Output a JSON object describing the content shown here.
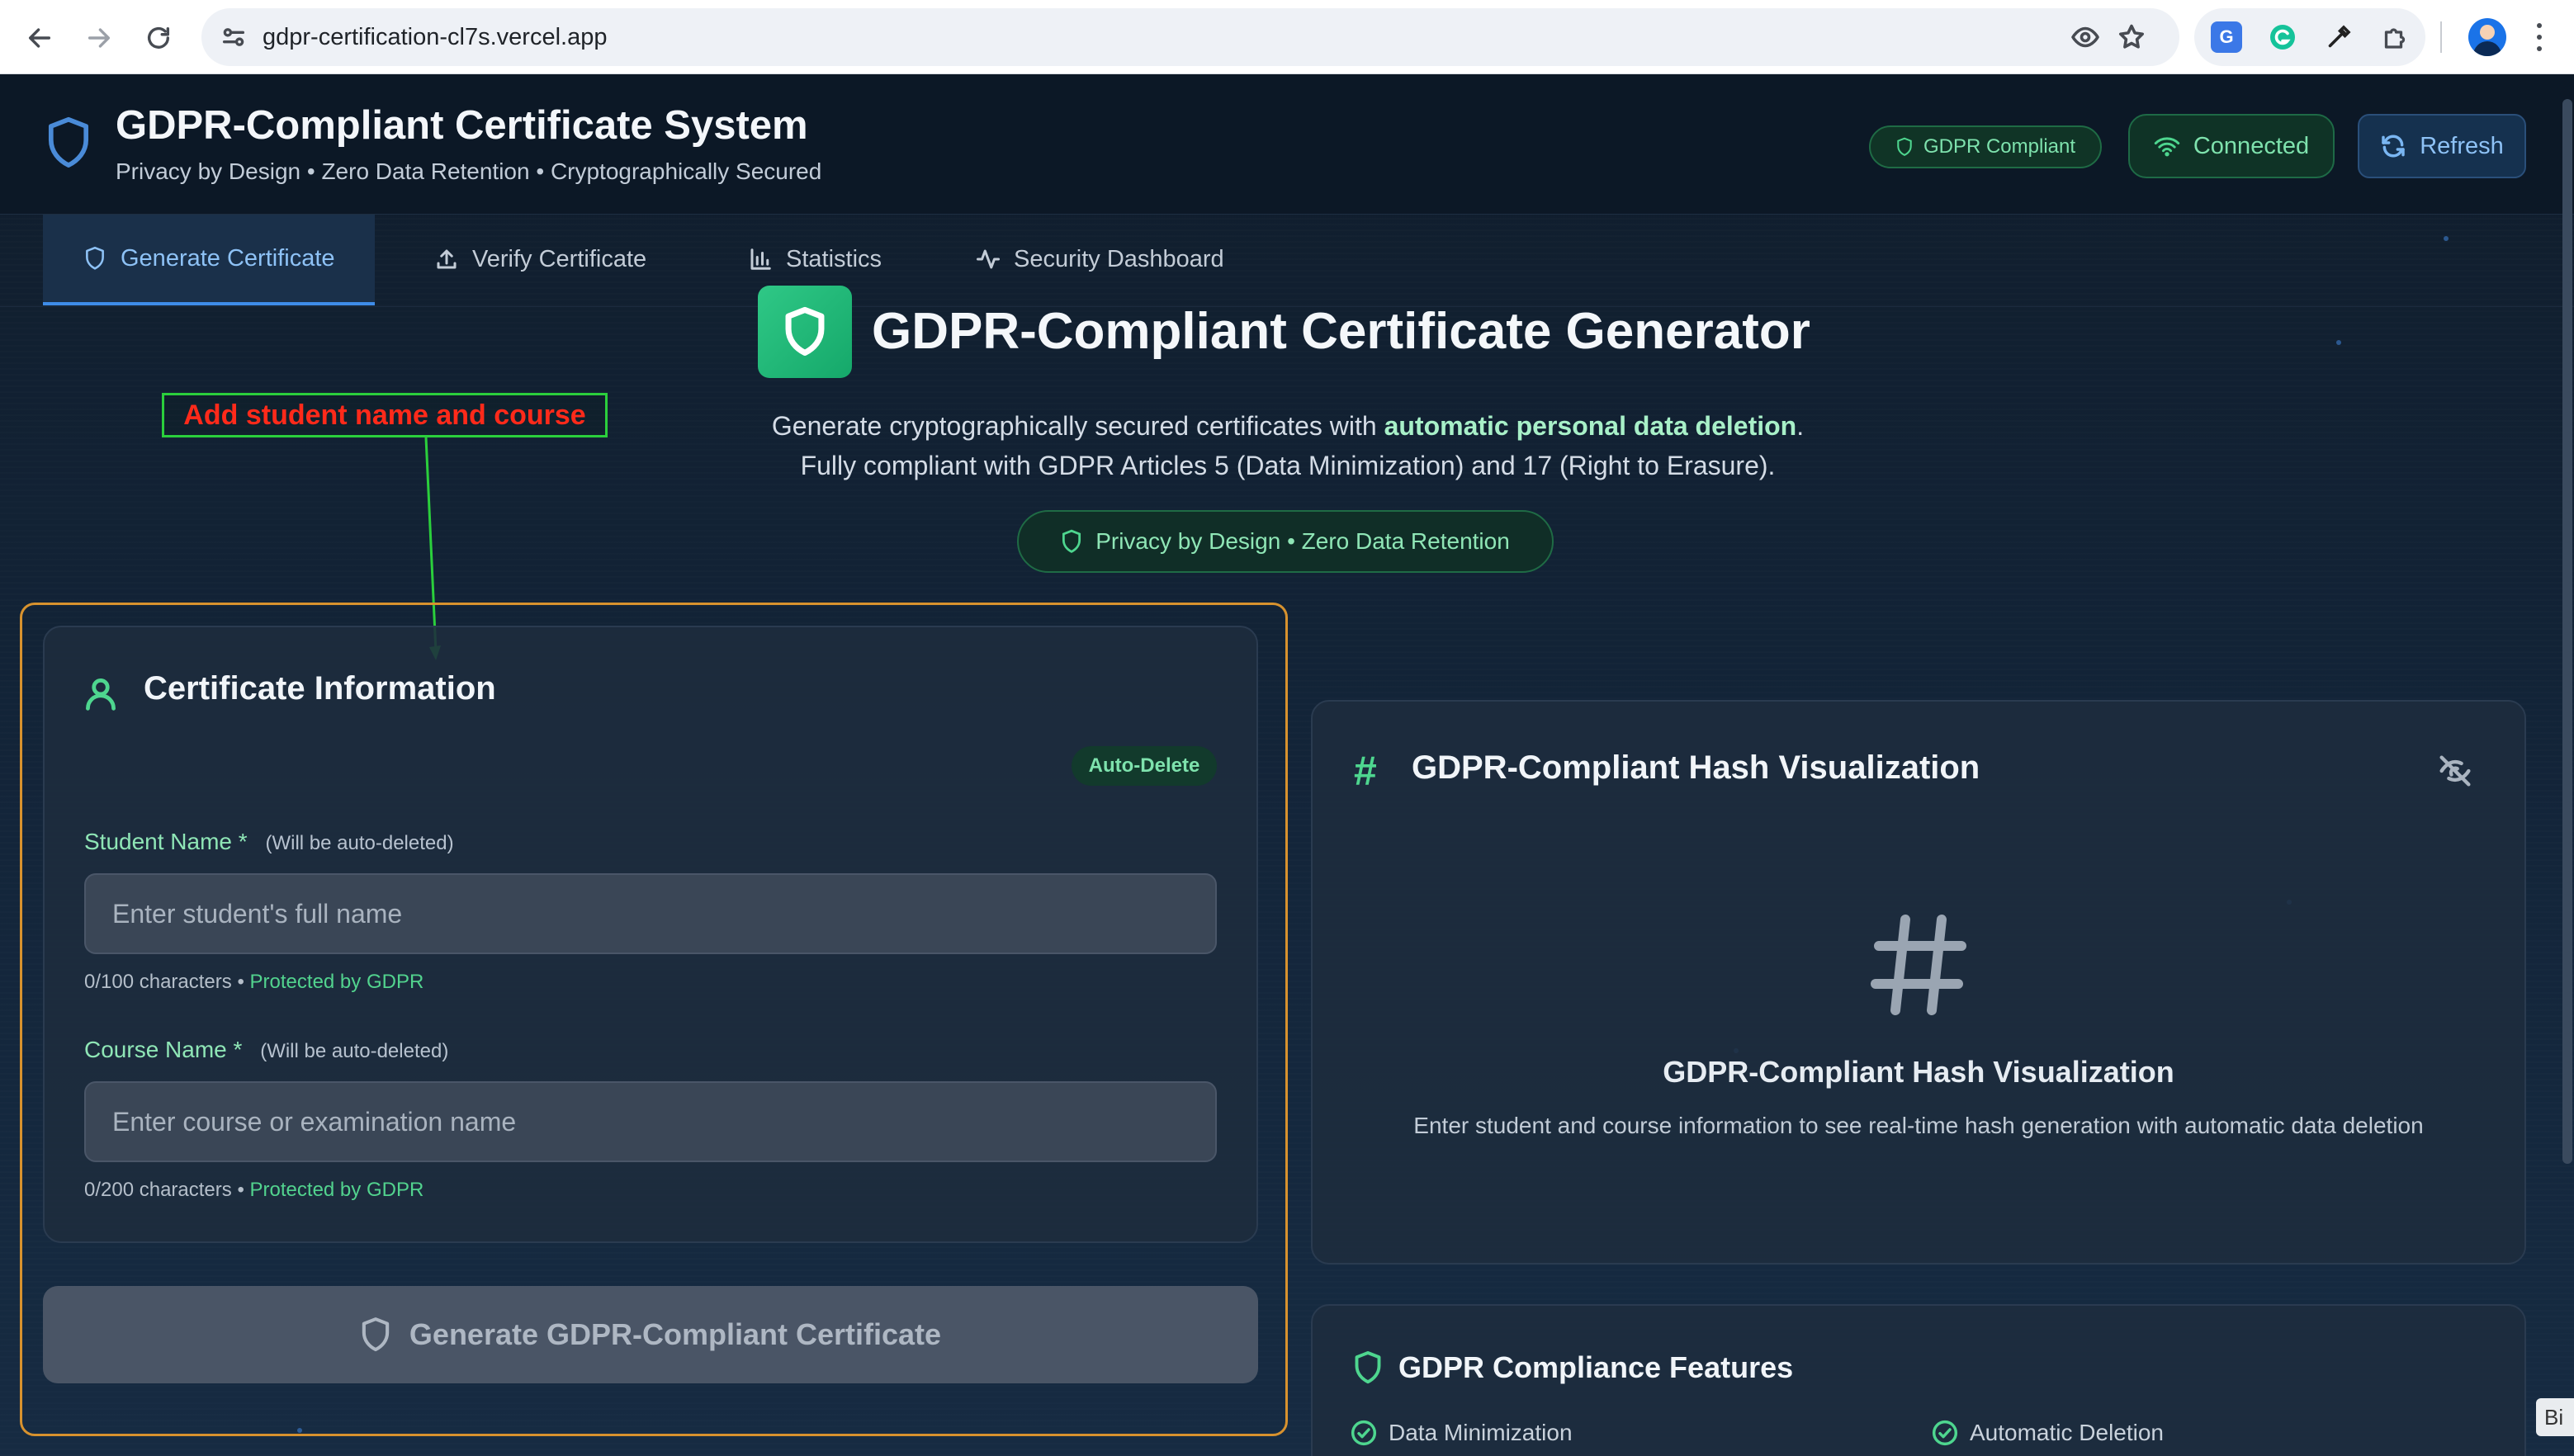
{
  "browser": {
    "url": "gdpr-certification-cl7s.vercel.app"
  },
  "header": {
    "title": "GDPR-Compliant Certificate System",
    "subtitle": "Privacy by Design • Zero Data Retention • Cryptographically Secured",
    "badge": "GDPR Compliant",
    "connected_label": "Connected",
    "refresh_label": "Refresh"
  },
  "tabs": [
    {
      "label": "Generate Certificate",
      "icon": "shield-icon",
      "active": true
    },
    {
      "label": "Verify Certificate",
      "icon": "upload-icon",
      "active": false
    },
    {
      "label": "Statistics",
      "icon": "bar-chart-icon",
      "active": false
    },
    {
      "label": "Security Dashboard",
      "icon": "activity-icon",
      "active": false
    }
  ],
  "hero": {
    "title": "GDPR-Compliant Certificate Generator",
    "desc_before": "Generate cryptographically secured certificates with ",
    "desc_bold": "automatic personal data deletion",
    "desc_after": ".",
    "desc_line2": "Fully compliant with GDPR Articles 5 (Data Minimization) and 17 (Right to Erasure).",
    "pill": "Privacy by Design • Zero Data Retention"
  },
  "annotation": {
    "text": "Add student name and course"
  },
  "certificate_info": {
    "title": "Certificate Information",
    "badge": "Auto-Delete",
    "student": {
      "label": "Student Name",
      "required": "*",
      "note": "(Will be auto-deleted)",
      "placeholder": "Enter student's full name",
      "value": "",
      "count": "0/100 characters",
      "bullet": "•",
      "protected": "Protected by GDPR"
    },
    "course": {
      "label": "Course Name",
      "required": "*",
      "note": "(Will be auto-deleted)",
      "placeholder": "Enter course or examination name",
      "value": "",
      "count": "0/200 characters",
      "bullet": "•",
      "protected": "Protected by GDPR"
    },
    "generate_label": "Generate GDPR-Compliant Certificate"
  },
  "hash_panel": {
    "title": "GDPR-Compliant Hash Visualization",
    "empty_title": "GDPR-Compliant Hash Visualization",
    "empty_desc": "Enter student and course information to see real-time hash generation with automatic data deletion"
  },
  "features": {
    "title": "GDPR Compliance Features",
    "items": [
      "Data Minimization",
      "Automatic Deletion"
    ]
  },
  "corner_tag": "Bi",
  "colors": {
    "accent_blue": "#3e8ce8",
    "accent_green": "#4ed68f",
    "annotation_red": "#ff2a1a",
    "annotation_green": "#2bcf3c",
    "outline_orange": "#d8922e"
  }
}
